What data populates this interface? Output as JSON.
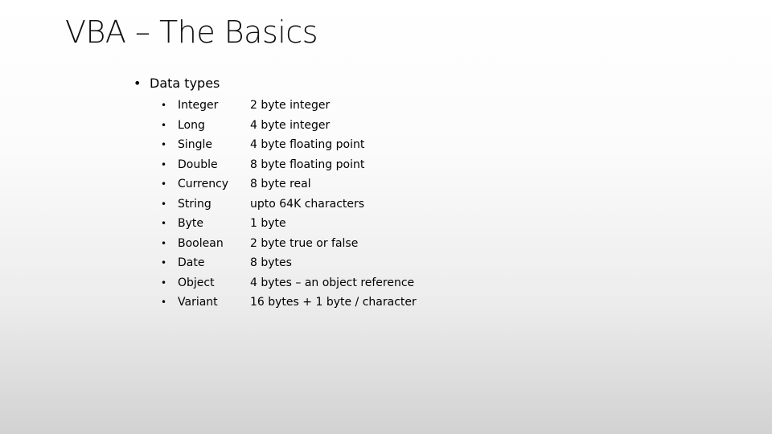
{
  "slide": {
    "title": "VBA – The Basics",
    "section": {
      "bullet": "•",
      "label": "Data types"
    },
    "data_types": [
      {
        "bullet": "•",
        "name": "Integer",
        "description": "2 byte integer"
      },
      {
        "bullet": "•",
        "name": "Long",
        "description": "4 byte integer"
      },
      {
        "bullet": "•",
        "name": "Single",
        "description": "4 byte floating point"
      },
      {
        "bullet": "•",
        "name": "Double",
        "description": "8 byte floating point"
      },
      {
        "bullet": "•",
        "name": "Currency",
        "description": "8 byte real"
      },
      {
        "bullet": "•",
        "name": "String",
        "description": "upto 64K characters"
      },
      {
        "bullet": "•",
        "name": "Byte",
        "description": "1 byte"
      },
      {
        "bullet": "•",
        "name": "Boolean",
        "description": "2 byte true or false"
      },
      {
        "bullet": "•",
        "name": "Date",
        "description": "8 bytes"
      },
      {
        "bullet": "•",
        "name": "Object",
        "description": "4 bytes – an object reference"
      },
      {
        "bullet": "•",
        "name": "Variant",
        "description": "16 bytes + 1 byte / character"
      }
    ]
  }
}
